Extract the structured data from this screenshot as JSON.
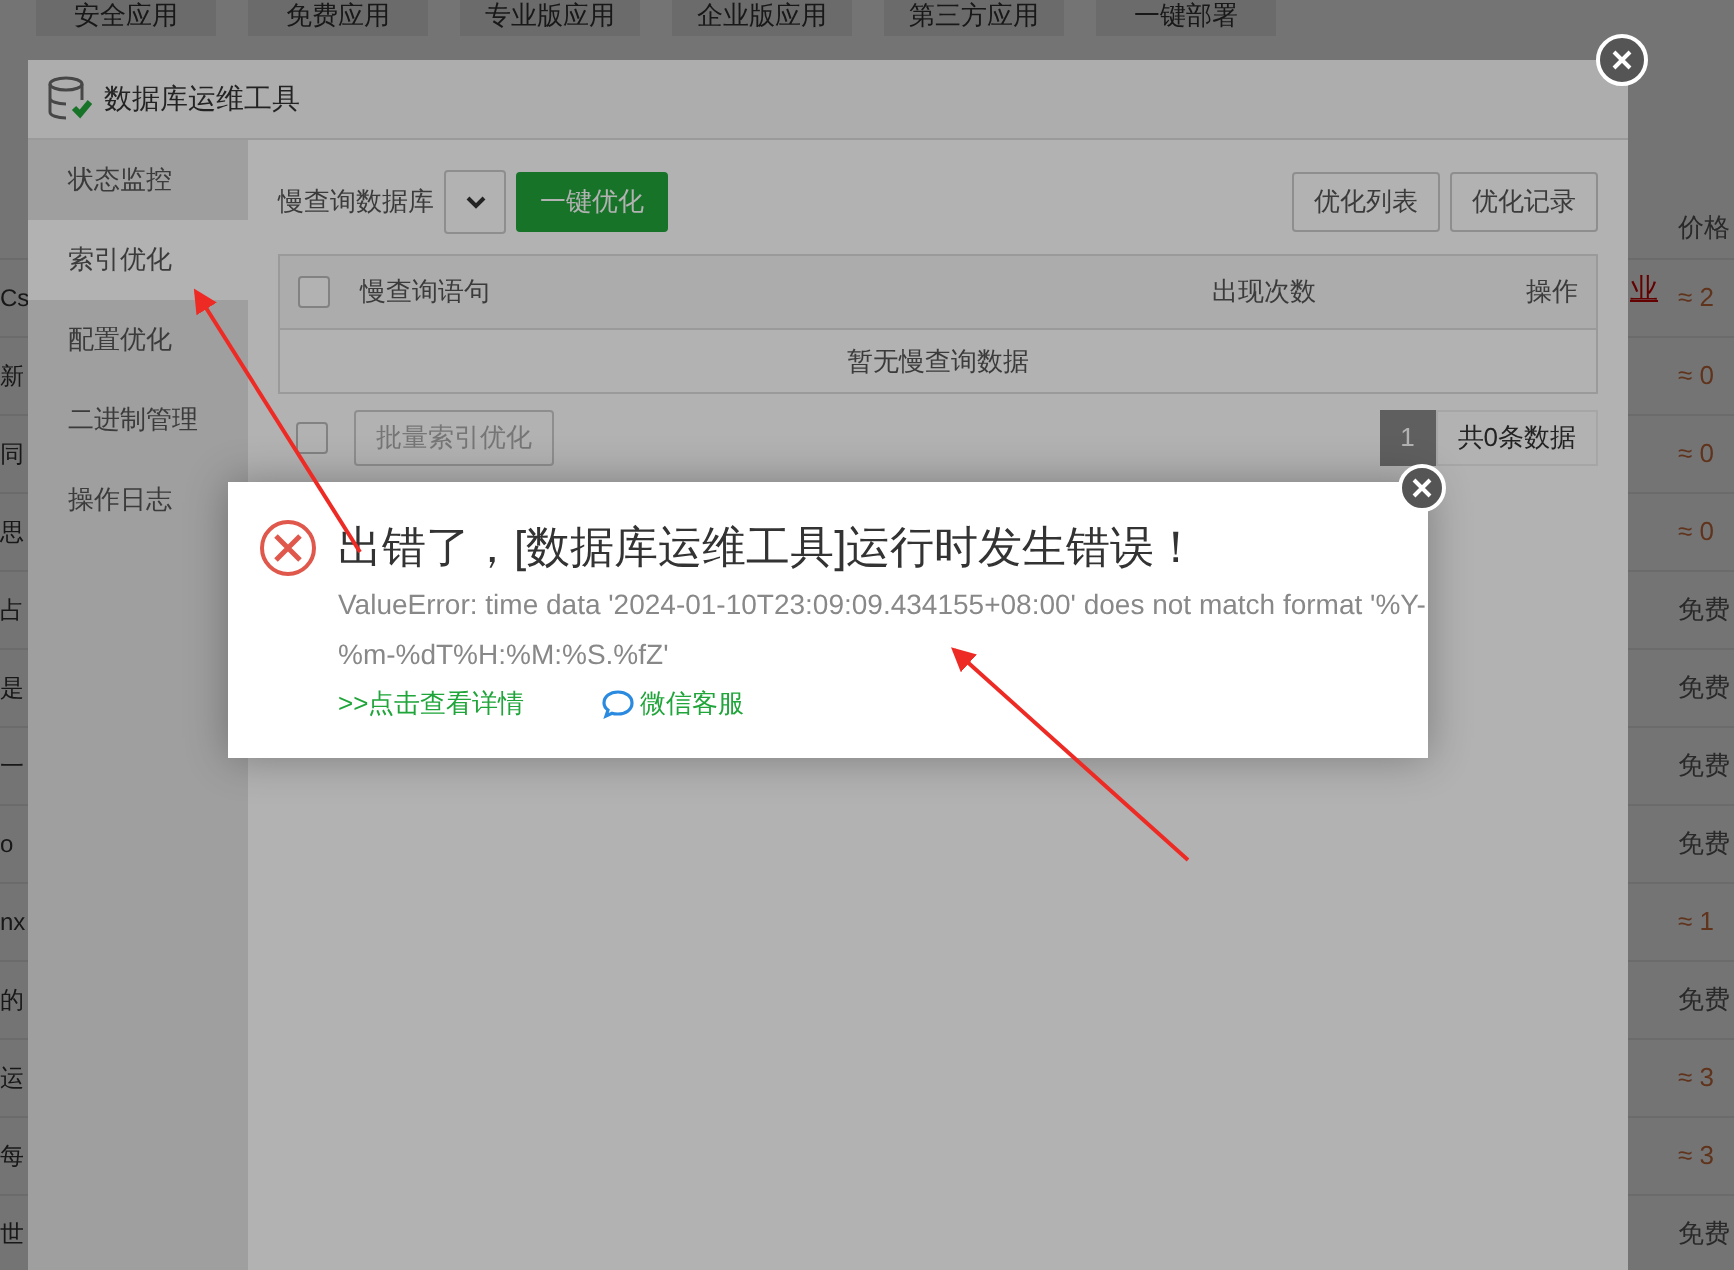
{
  "background_page": {
    "tabs": [
      "安全应用",
      "免费应用",
      "专业版应用",
      "企业版应用",
      "第三方应用",
      "一键部署"
    ],
    "price_header": "价格",
    "link_fragment": "业",
    "rows": [
      {
        "name": "Cs",
        "price": "≈ 2",
        "kind": "paid"
      },
      {
        "name": "新",
        "price": "≈ 0",
        "kind": "paid"
      },
      {
        "name": "同",
        "price": "≈ 0",
        "kind": "paid"
      },
      {
        "name": "思",
        "price": "≈ 0",
        "kind": "paid"
      },
      {
        "name": "占",
        "price": "免费",
        "kind": "free"
      },
      {
        "name": "是",
        "price": "免费",
        "kind": "free"
      },
      {
        "name": "一",
        "price": "免费",
        "kind": "free"
      },
      {
        "name": "o",
        "price": "免费",
        "kind": "free"
      },
      {
        "name": "nx",
        "price": "≈ 1",
        "kind": "paid"
      },
      {
        "name": "的",
        "price": "免费",
        "kind": "free"
      },
      {
        "name": "运",
        "price": "≈ 3",
        "kind": "paid"
      },
      {
        "name": "每",
        "price": "≈ 3",
        "kind": "paid"
      },
      {
        "name": "世",
        "price": "免费",
        "kind": "free"
      }
    ]
  },
  "tool_window": {
    "title": "数据库运维工具",
    "sidebar": [
      {
        "label": "状态监控",
        "selected": false
      },
      {
        "label": "索引优化",
        "selected": true
      },
      {
        "label": "配置优化",
        "selected": false
      },
      {
        "label": "二进制管理",
        "selected": false
      },
      {
        "label": "操作日志",
        "selected": false
      }
    ],
    "toolbar": {
      "label": "慢查询数据库",
      "optimize_button": "一键优化",
      "buttons": [
        "优化列表",
        "优化记录"
      ]
    },
    "table": {
      "select_all_checked": false,
      "columns": [
        "慢查询语句",
        "出现次数",
        "操作"
      ],
      "empty_text": "暂无慢查询数据"
    },
    "footer": {
      "checkbox_checked": false,
      "batch_button": "批量索引优化",
      "page": "1",
      "total": "共0条数据"
    }
  },
  "error_dialog": {
    "title": "出错了，[数据库运维工具]运行时发生错误！",
    "message": "ValueError: time data '2024-01-10T23:09:09.434155+08:00' does not match format '%Y-%m-%dT%H:%M:%S.%fZ'",
    "details_link": ">>点击查看详情",
    "support_link": "微信客服"
  }
}
